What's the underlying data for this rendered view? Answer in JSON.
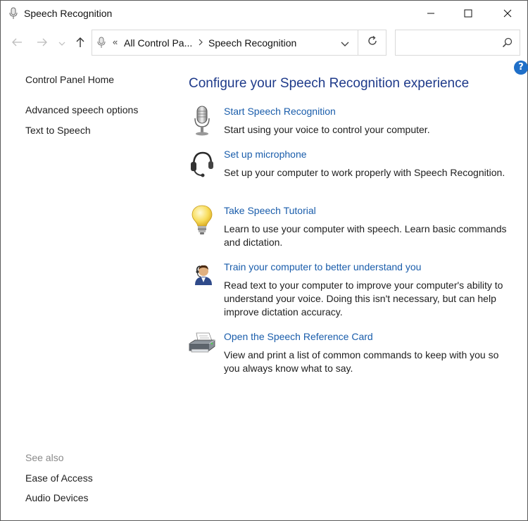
{
  "window": {
    "title": "Speech Recognition",
    "icon": "microphone-icon"
  },
  "address_bar": {
    "overflow_chevron": "«",
    "crumbs": [
      "All Control Pa...",
      "Speech Recognition"
    ],
    "search_placeholder": ""
  },
  "help": {
    "label": "?"
  },
  "sidebar": {
    "home": "Control Panel Home",
    "links": [
      "Advanced speech options",
      "Text to Speech"
    ],
    "see_also_label": "See also",
    "see_also_links": [
      "Ease of Access",
      "Audio Devices"
    ]
  },
  "main": {
    "heading": "Configure your Speech Recognition experience",
    "tasks": [
      {
        "icon": "microphone-icon",
        "link": "Start Speech Recognition",
        "description": "Start using your voice to control your computer."
      },
      {
        "icon": "headset-icon",
        "link": "Set up microphone",
        "description": "Set up your computer to work properly with Speech Recognition."
      },
      {
        "icon": "lightbulb-icon",
        "link": "Take Speech Tutorial",
        "description": "Learn to use your computer with speech.  Learn basic commands and dictation."
      },
      {
        "icon": "user-icon",
        "link": "Train your computer to better understand you",
        "description": "Read text to your computer to improve your computer's ability to understand your voice.  Doing this isn't necessary, but can help improve dictation accuracy."
      },
      {
        "icon": "printer-icon",
        "link": "Open the Speech Reference Card",
        "description": "View and print a list of common commands to keep with you so you always know what to say."
      }
    ]
  },
  "colors": {
    "link": "#1a5dab",
    "heading": "#1e3a8a",
    "help_badge": "#1f6fc8"
  }
}
